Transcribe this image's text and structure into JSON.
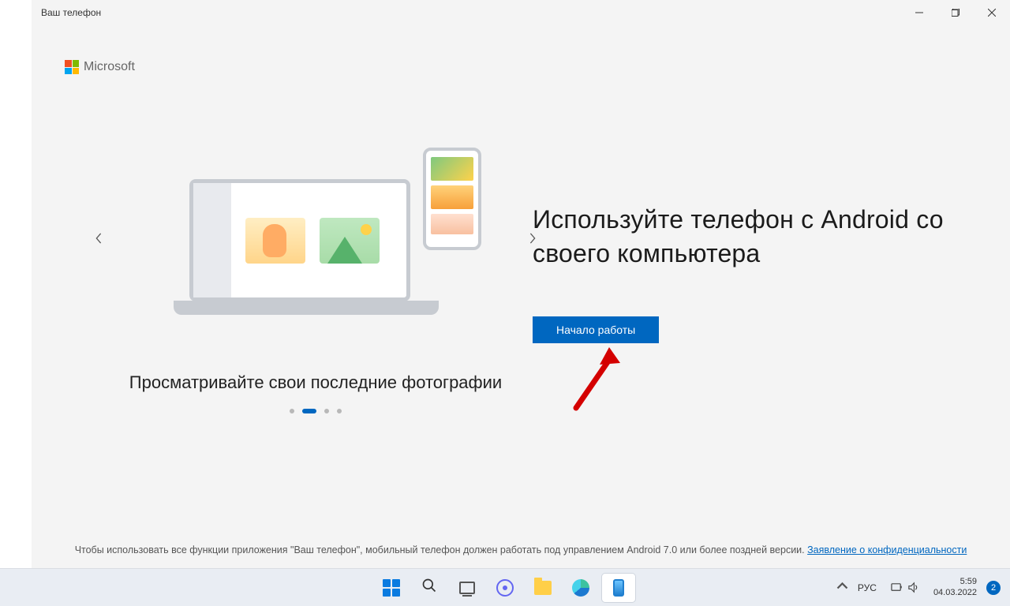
{
  "window": {
    "title": "Ваш телефон"
  },
  "brand": {
    "name": "Microsoft"
  },
  "carousel": {
    "caption": "Просматривайте свои последние фотографии",
    "active_index": 1,
    "total": 4
  },
  "hero": {
    "headline": "Используйте телефон с Android со своего компьютера",
    "cta": "Начало работы"
  },
  "footnote": {
    "text": "Чтобы использовать все функции приложения \"Ваш телефон\", мобильный телефон должен работать под управлением Android 7.0 или более поздней версии. ",
    "link": "Заявление о конфиденциальности"
  },
  "tray": {
    "lang": "РУС",
    "time": "5:59",
    "date": "04.03.2022",
    "notif_count": "2"
  }
}
